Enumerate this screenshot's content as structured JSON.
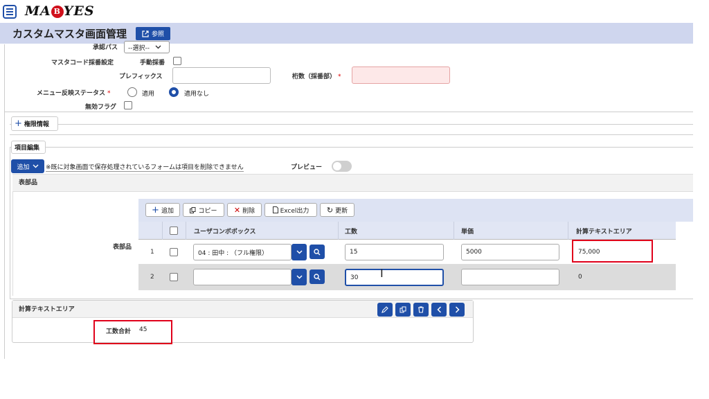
{
  "header": {
    "logo_text": "MA BYES",
    "logo_left": "MA",
    "logo_badge": "B",
    "logo_right": "YES",
    "title": "カスタムマスタ画面管理",
    "ref_button": "参照"
  },
  "form": {
    "approval_path_label": "承認パス",
    "approval_path_value": "--選択--",
    "master_code_label": "マスタコード採番設定",
    "manual_numbering_label": "手動採番",
    "prefix_label": "プレフィックス",
    "digits_label": "桁数（採番部）",
    "required_mark": "*",
    "menu_status_label": "メニュー反映ステータス",
    "radio_apply": "適用",
    "radio_not_apply": "適用なし",
    "invalid_flag_label": "無効フラグ"
  },
  "permissions_section": {
    "label": "権限情報"
  },
  "items_section": {
    "label": "項目編集",
    "add_button": "追加",
    "notice": "※既に対象画面で保存処理されているフォームは項目を削除できません",
    "preview_label": "プレビュー"
  },
  "table_part": {
    "section_title": "表部品",
    "row_label": "表部品",
    "toolbar": {
      "add": "追加",
      "copy": "コピー",
      "delete": "削除",
      "excel": "Excel出力",
      "refresh": "更新"
    },
    "columns": [
      "ユーザコンボボックス",
      "工数",
      "単価",
      "計算テキストエリア"
    ],
    "rows": [
      {
        "num": "1",
        "user": "04 : 田中 : （フル権限）",
        "hours": "15",
        "price": "5000",
        "calc": "75,000"
      },
      {
        "num": "2",
        "user": "",
        "hours": "30",
        "price": "",
        "calc": "0"
      }
    ]
  },
  "calc_area": {
    "title": "計算テキストエリア",
    "total_label": "工数合計",
    "total_value": "45"
  }
}
